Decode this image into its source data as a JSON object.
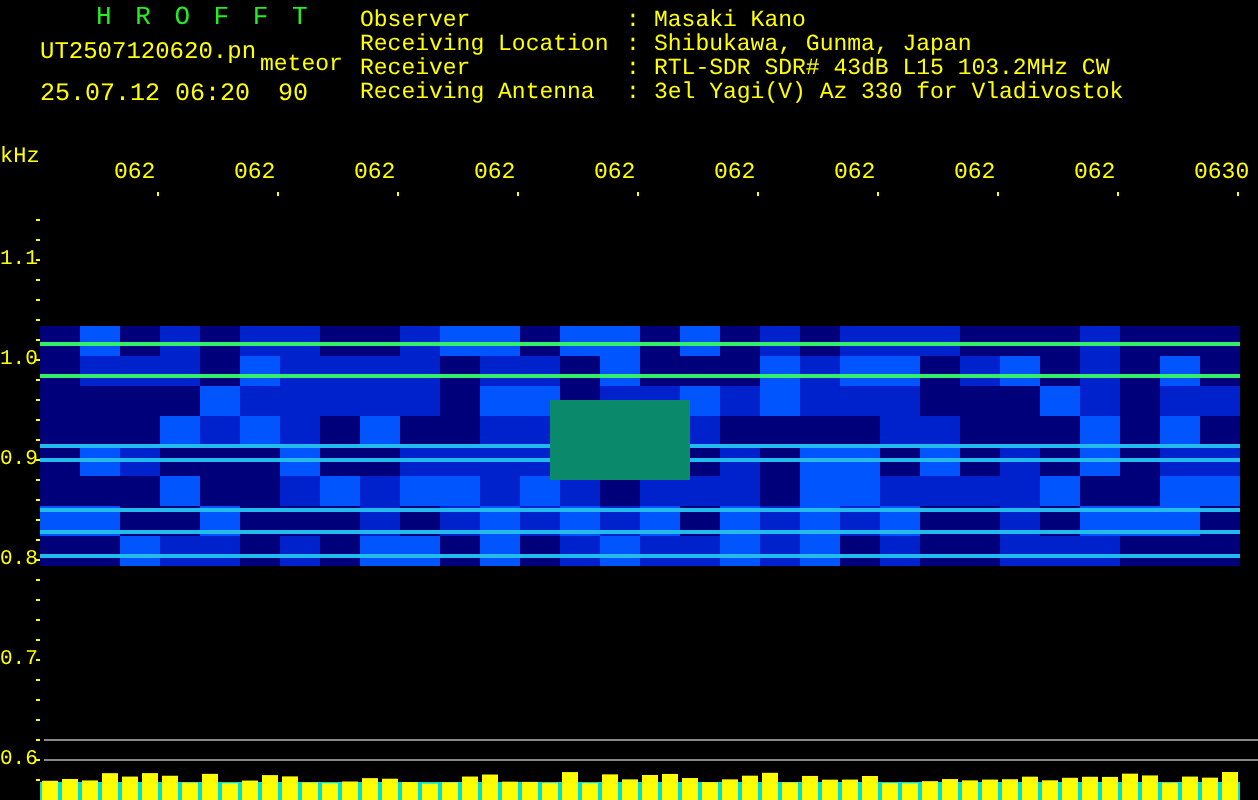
{
  "title": "H R O F F T",
  "file_name": "UT2507120620.pn",
  "mode": "meteor",
  "timestamp": "25.07.12 06:20",
  "value": "90",
  "info": [
    {
      "label": "Observer",
      "separator": ":",
      "value": "Masaki Kano"
    },
    {
      "label": "Receiving Location",
      "separator": ":",
      "value": "Shibukawa, Gunma, Japan"
    },
    {
      "label": "Receiver",
      "separator": ":",
      "value": "RTL-SDR SDR# 43dB L15 103.2MHz CW"
    },
    {
      "label": "Receiving Antenna",
      "separator": ":",
      "value": "3el Yagi(V) Az 330 for Vladivostok"
    }
  ],
  "y_axis": {
    "unit": "kHz",
    "labels": [
      "1.1",
      "1.0",
      "0.9",
      "0.8",
      "0.7",
      "0.6"
    ]
  },
  "x_axis": {
    "labels": [
      "062",
      "062",
      "062",
      "062",
      "062",
      "062",
      "062",
      "062",
      "062",
      "0630"
    ]
  }
}
